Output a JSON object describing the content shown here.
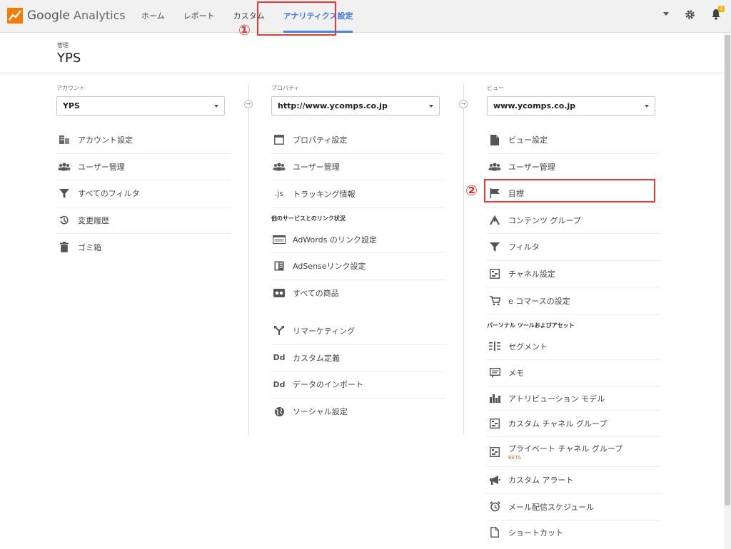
{
  "app": {
    "logo_google": "Google",
    "logo_analytics": "Analytics"
  },
  "nav": {
    "home": "ホーム",
    "reports": "レポート",
    "custom": "カスタム",
    "admin": "アナリティクス設定"
  },
  "callouts": {
    "one": "①",
    "two": "②"
  },
  "notifications": {
    "badge": "1"
  },
  "header": {
    "admin_label": "管理",
    "account_name": "YPS"
  },
  "account": {
    "label": "アカウント",
    "selected": "YPS",
    "items": [
      "アカウント設定",
      "ユーザー管理",
      "すべてのフィルタ",
      "変更履歴",
      "ゴミ箱"
    ]
  },
  "property": {
    "label": "プロパティ",
    "selected": "http://www.ycomps.co.jp",
    "items": [
      "プロパティ設定",
      "ユーザー管理",
      "トラッキング情報"
    ],
    "tracking_icon_text": ".js",
    "linked_heading": "他のサービスとのリンク状況",
    "linked_items": [
      "AdWords のリンク設定",
      "AdSenseリンク設定",
      "すべての商品"
    ],
    "other_items": [
      "リマーケティング",
      "カスタム定義",
      "データのインポート",
      "ソーシャル設定"
    ],
    "dd_icon_text": "Dd"
  },
  "view": {
    "label": "ビュー",
    "selected": "www.ycomps.co.jp",
    "items": [
      "ビュー設定",
      "ユーザー管理",
      "目標",
      "コンテンツ グループ",
      "フィルタ",
      "チャネル設定",
      "e コマースの設定"
    ],
    "personal_heading": "パーソナル ツールおよびアセット",
    "personal_items": [
      "セグメント",
      "メモ",
      "アトリビューション モデル",
      "カスタム チャネル グループ",
      "プライベート チャネル グループ",
      "カスタム アラート",
      "メール配信スケジュール",
      "ショートカット"
    ],
    "beta_label": "BETA"
  },
  "colors": {
    "accent": "#4285f4",
    "callout": "#e53935",
    "beta": "#e06c1f"
  }
}
